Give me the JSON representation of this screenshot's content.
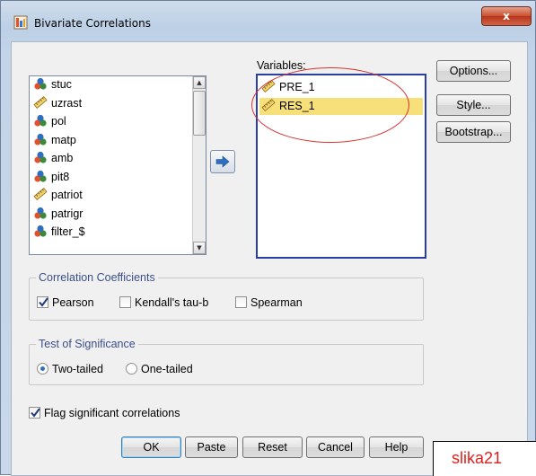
{
  "window": {
    "title": "Bivariate Correlations",
    "close_label": "x"
  },
  "source_list": {
    "items": [
      {
        "label": "stuc",
        "icon": "nominal-icon"
      },
      {
        "label": "uzrast",
        "icon": "scale-icon"
      },
      {
        "label": "pol",
        "icon": "nominal-icon"
      },
      {
        "label": "matp",
        "icon": "nominal-icon"
      },
      {
        "label": "amb",
        "icon": "nominal-icon"
      },
      {
        "label": "pit8",
        "icon": "nominal-icon"
      },
      {
        "label": "patriot",
        "icon": "scale-icon"
      },
      {
        "label": "patrigr",
        "icon": "nominal-icon"
      },
      {
        "label": "filter_$",
        "icon": "nominal-icon"
      }
    ]
  },
  "variables": {
    "label": "Variables:",
    "items": [
      {
        "label": "PRE_1",
        "icon": "scale-icon",
        "selected": false
      },
      {
        "label": "RES_1",
        "icon": "scale-icon",
        "selected": true
      }
    ]
  },
  "side_buttons": {
    "options": "Options...",
    "style": "Style...",
    "bootstrap": "Bootstrap..."
  },
  "correlation": {
    "legend": "Correlation Coefficients",
    "pearson": "Pearson",
    "pearson_checked": true,
    "kendall": "Kendall's tau-b",
    "kendall_checked": false,
    "spearman": "Spearman",
    "spearman_checked": false
  },
  "significance": {
    "legend": "Test of Significance",
    "two_tailed": "Two-tailed",
    "one_tailed": "One-tailed",
    "selected": "two_tailed"
  },
  "flag": {
    "label": "Flag significant correlations",
    "checked": true
  },
  "footer_buttons": {
    "ok": "OK",
    "paste": "Paste",
    "reset": "Reset",
    "cancel": "Cancel",
    "help": "Help"
  },
  "annotation": {
    "caption": "slika21",
    "color": "#e0201c"
  },
  "colors": {
    "selection": "#f7e07a",
    "legend_text": "#3a4f8a",
    "highlight_ellipse": "#d8322f"
  }
}
